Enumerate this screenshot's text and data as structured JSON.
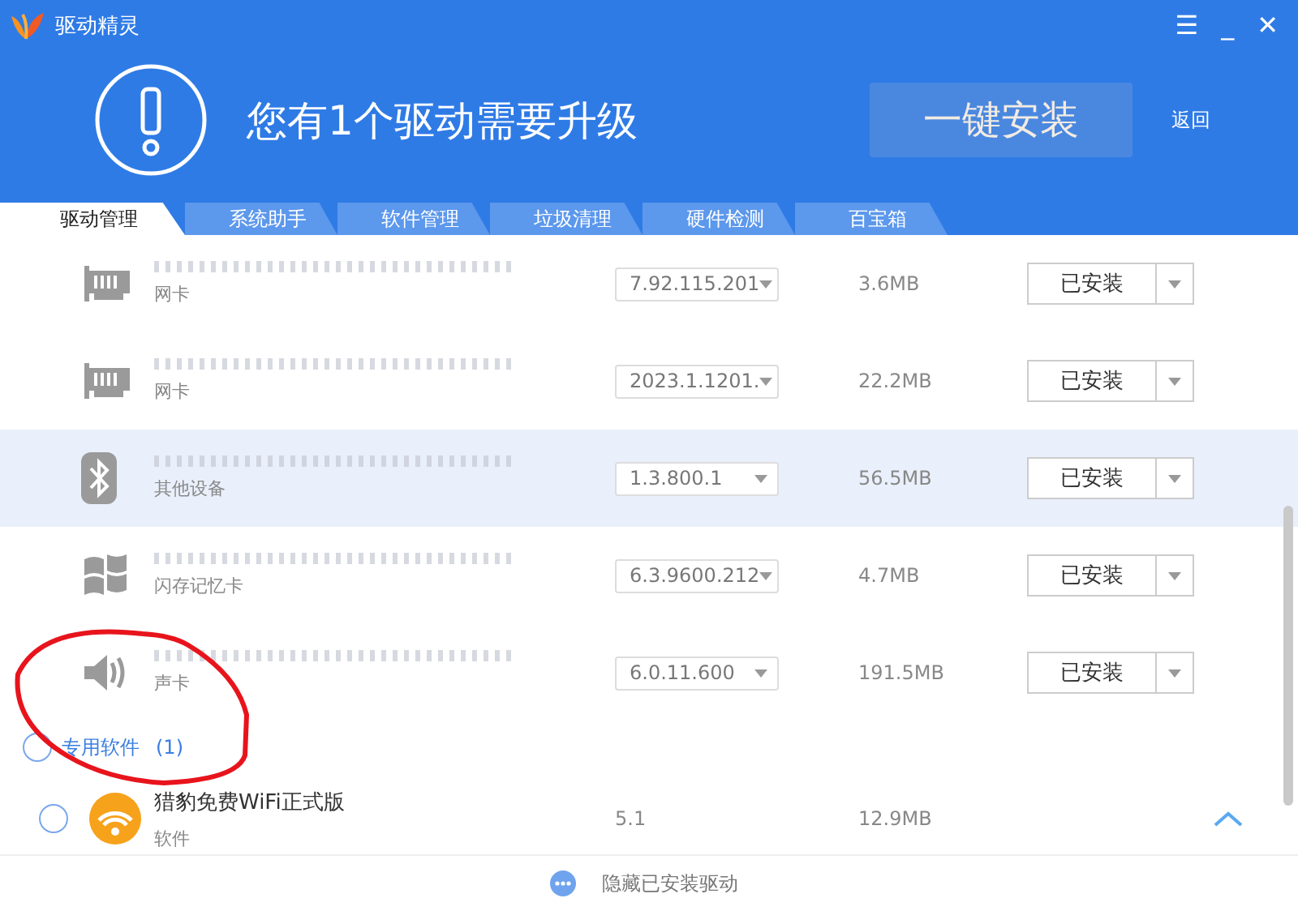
{
  "window": {
    "title": "驱动精灵",
    "controls": [
      "☰",
      "_",
      "✕"
    ]
  },
  "banner": {
    "message": "您有1个驱动需要升级",
    "install_button": "一键安装",
    "install_disabled": true,
    "back_link": "返回"
  },
  "tabs": [
    {
      "label": "驱动管理",
      "selected": true
    },
    {
      "label": "系统助手",
      "selected": false
    },
    {
      "label": "软件管理",
      "selected": false
    },
    {
      "label": "垃圾清理",
      "selected": false
    },
    {
      "label": "硬件检测",
      "selected": false
    },
    {
      "label": "百宝箱",
      "selected": false
    }
  ],
  "drivers": [
    {
      "kind": "network",
      "category": "网卡",
      "version": "7.92.115.201",
      "size": "3.6MB",
      "action": "已安装",
      "hovered": false
    },
    {
      "kind": "network",
      "category": "网卡",
      "version": "2023.1.1201.",
      "size": "22.2MB",
      "action": "已安装",
      "hovered": false
    },
    {
      "kind": "bluetooth",
      "category": "其他设备",
      "version": "1.3.800.1",
      "size": "56.5MB",
      "action": "已安装",
      "hovered": true
    },
    {
      "kind": "windows",
      "category": "闪存记忆卡",
      "version": "6.3.9600.212",
      "size": "4.7MB",
      "action": "已安装",
      "hovered": false
    },
    {
      "kind": "speaker",
      "category": "声卡",
      "version": "6.0.11.600",
      "size": "191.5MB",
      "action": "已安装",
      "hovered": false
    }
  ],
  "software_group": {
    "label": "专用软件",
    "count": "(1)",
    "checked": false
  },
  "software": [
    {
      "name": "猎豹免费WiFi正式版",
      "category": "软件",
      "version": "5.1",
      "size": "12.9MB",
      "checked": false
    }
  ],
  "footer": {
    "label": "隐藏已安装驱动"
  }
}
